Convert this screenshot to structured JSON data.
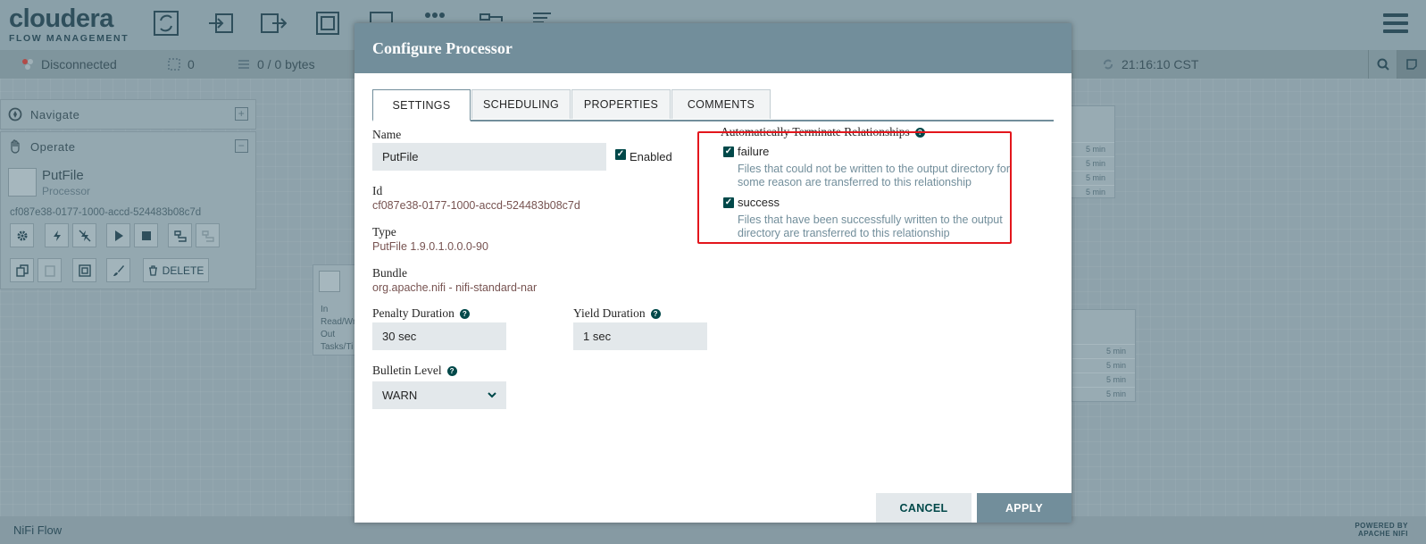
{
  "header": {
    "brand": "cloudera",
    "sub_brand": "FLOW MANAGEMENT",
    "toolbar_icons": [
      "processor-icon",
      "input-port-icon",
      "output-port-icon",
      "process-group-icon",
      "remote-process-group-icon",
      "funnel-icon",
      "template-icon",
      "label-icon"
    ]
  },
  "statusbar": {
    "connection": "Disconnected",
    "threads": "0",
    "queued": "0 / 0 bytes",
    "time": "21:16:10 CST"
  },
  "navigate_panel": {
    "title": "Navigate"
  },
  "operate_panel": {
    "title": "Operate",
    "component_name": "PutFile",
    "component_type": "Processor",
    "component_id": "cf087e38-0177-1000-accd-524483b08c7d",
    "delete_label": "DELETE"
  },
  "canvas": {
    "card_left_labels": [
      "In",
      "Read/Wr",
      "Out",
      "Tasks/Ti"
    ],
    "card_right_top_rows": [
      "5 min",
      "5 min",
      "5 min",
      "5 min"
    ],
    "card_right_bottom_rows": [
      "5 min",
      "5 min",
      "5 min",
      "5 min"
    ]
  },
  "footer": {
    "flow_name": "NiFi Flow",
    "powered_line1": "POWERED BY",
    "powered_line2": "APACHE NIFI"
  },
  "dialog": {
    "title": "Configure Processor",
    "tabs": [
      "SETTINGS",
      "SCHEDULING",
      "PROPERTIES",
      "COMMENTS"
    ],
    "active_tab": "SETTINGS",
    "name_label": "Name",
    "name_value": "PutFile",
    "enabled_label": "Enabled",
    "enabled": true,
    "id_label": "Id",
    "id_value": "cf087e38-0177-1000-accd-524483b08c7d",
    "type_label": "Type",
    "type_value": "PutFile 1.9.0.1.0.0.0-90",
    "bundle_label": "Bundle",
    "bundle_value": "org.apache.nifi - nifi-standard-nar",
    "penalty_label": "Penalty Duration",
    "penalty_value": "30 sec",
    "yield_label": "Yield Duration",
    "yield_value": "1 sec",
    "bulletin_label": "Bulletin Level",
    "bulletin_value": "WARN",
    "auto_terminate_label": "Automatically Terminate Relationships",
    "relationships": [
      {
        "name": "failure",
        "checked": true,
        "description": "Files that could not be written to the output directory for some reason are transferred to this relationship"
      },
      {
        "name": "success",
        "checked": true,
        "description": "Files that have been successfully written to the output directory are transferred to this relationship"
      }
    ],
    "cancel_label": "CANCEL",
    "apply_label": "APPLY",
    "highlight_color": "#e3161c"
  },
  "colors": {
    "header_bg": "#8aa0a9",
    "dialog_header": "#728e9b",
    "value_text": "#775351",
    "check": "#004849"
  }
}
